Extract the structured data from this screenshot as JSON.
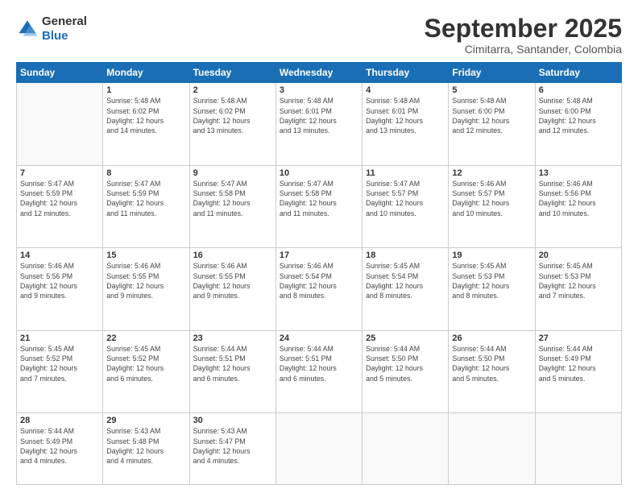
{
  "logo": {
    "line1": "General",
    "line2": "Blue"
  },
  "header": {
    "month": "September 2025",
    "location": "Cimitarra, Santander, Colombia"
  },
  "weekdays": [
    "Sunday",
    "Monday",
    "Tuesday",
    "Wednesday",
    "Thursday",
    "Friday",
    "Saturday"
  ],
  "weeks": [
    [
      {
        "day": "",
        "info": ""
      },
      {
        "day": "1",
        "info": "Sunrise: 5:48 AM\nSunset: 6:02 PM\nDaylight: 12 hours\nand 14 minutes."
      },
      {
        "day": "2",
        "info": "Sunrise: 5:48 AM\nSunset: 6:02 PM\nDaylight: 12 hours\nand 13 minutes."
      },
      {
        "day": "3",
        "info": "Sunrise: 5:48 AM\nSunset: 6:01 PM\nDaylight: 12 hours\nand 13 minutes."
      },
      {
        "day": "4",
        "info": "Sunrise: 5:48 AM\nSunset: 6:01 PM\nDaylight: 12 hours\nand 13 minutes."
      },
      {
        "day": "5",
        "info": "Sunrise: 5:48 AM\nSunset: 6:00 PM\nDaylight: 12 hours\nand 12 minutes."
      },
      {
        "day": "6",
        "info": "Sunrise: 5:48 AM\nSunset: 6:00 PM\nDaylight: 12 hours\nand 12 minutes."
      }
    ],
    [
      {
        "day": "7",
        "info": "Sunrise: 5:47 AM\nSunset: 5:59 PM\nDaylight: 12 hours\nand 12 minutes."
      },
      {
        "day": "8",
        "info": "Sunrise: 5:47 AM\nSunset: 5:59 PM\nDaylight: 12 hours\nand 11 minutes."
      },
      {
        "day": "9",
        "info": "Sunrise: 5:47 AM\nSunset: 5:58 PM\nDaylight: 12 hours\nand 11 minutes."
      },
      {
        "day": "10",
        "info": "Sunrise: 5:47 AM\nSunset: 5:58 PM\nDaylight: 12 hours\nand 11 minutes."
      },
      {
        "day": "11",
        "info": "Sunrise: 5:47 AM\nSunset: 5:57 PM\nDaylight: 12 hours\nand 10 minutes."
      },
      {
        "day": "12",
        "info": "Sunrise: 5:46 AM\nSunset: 5:57 PM\nDaylight: 12 hours\nand 10 minutes."
      },
      {
        "day": "13",
        "info": "Sunrise: 5:46 AM\nSunset: 5:56 PM\nDaylight: 12 hours\nand 10 minutes."
      }
    ],
    [
      {
        "day": "14",
        "info": "Sunrise: 5:46 AM\nSunset: 5:56 PM\nDaylight: 12 hours\nand 9 minutes."
      },
      {
        "day": "15",
        "info": "Sunrise: 5:46 AM\nSunset: 5:55 PM\nDaylight: 12 hours\nand 9 minutes."
      },
      {
        "day": "16",
        "info": "Sunrise: 5:46 AM\nSunset: 5:55 PM\nDaylight: 12 hours\nand 9 minutes."
      },
      {
        "day": "17",
        "info": "Sunrise: 5:46 AM\nSunset: 5:54 PM\nDaylight: 12 hours\nand 8 minutes."
      },
      {
        "day": "18",
        "info": "Sunrise: 5:45 AM\nSunset: 5:54 PM\nDaylight: 12 hours\nand 8 minutes."
      },
      {
        "day": "19",
        "info": "Sunrise: 5:45 AM\nSunset: 5:53 PM\nDaylight: 12 hours\nand 8 minutes."
      },
      {
        "day": "20",
        "info": "Sunrise: 5:45 AM\nSunset: 5:53 PM\nDaylight: 12 hours\nand 7 minutes."
      }
    ],
    [
      {
        "day": "21",
        "info": "Sunrise: 5:45 AM\nSunset: 5:52 PM\nDaylight: 12 hours\nand 7 minutes."
      },
      {
        "day": "22",
        "info": "Sunrise: 5:45 AM\nSunset: 5:52 PM\nDaylight: 12 hours\nand 6 minutes."
      },
      {
        "day": "23",
        "info": "Sunrise: 5:44 AM\nSunset: 5:51 PM\nDaylight: 12 hours\nand 6 minutes."
      },
      {
        "day": "24",
        "info": "Sunrise: 5:44 AM\nSunset: 5:51 PM\nDaylight: 12 hours\nand 6 minutes."
      },
      {
        "day": "25",
        "info": "Sunrise: 5:44 AM\nSunset: 5:50 PM\nDaylight: 12 hours\nand 5 minutes."
      },
      {
        "day": "26",
        "info": "Sunrise: 5:44 AM\nSunset: 5:50 PM\nDaylight: 12 hours\nand 5 minutes."
      },
      {
        "day": "27",
        "info": "Sunrise: 5:44 AM\nSunset: 5:49 PM\nDaylight: 12 hours\nand 5 minutes."
      }
    ],
    [
      {
        "day": "28",
        "info": "Sunrise: 5:44 AM\nSunset: 5:49 PM\nDaylight: 12 hours\nand 4 minutes."
      },
      {
        "day": "29",
        "info": "Sunrise: 5:43 AM\nSunset: 5:48 PM\nDaylight: 12 hours\nand 4 minutes."
      },
      {
        "day": "30",
        "info": "Sunrise: 5:43 AM\nSunset: 5:47 PM\nDaylight: 12 hours\nand 4 minutes."
      },
      {
        "day": "",
        "info": ""
      },
      {
        "day": "",
        "info": ""
      },
      {
        "day": "",
        "info": ""
      },
      {
        "day": "",
        "info": ""
      }
    ]
  ]
}
